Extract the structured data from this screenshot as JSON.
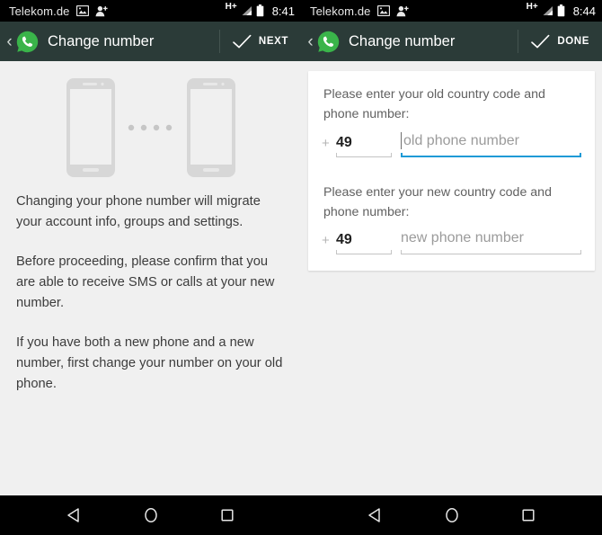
{
  "panels": [
    {
      "status_bar": {
        "carrier": "Telekom.de",
        "network_type": "H+",
        "time": "8:41",
        "icons": [
          "photo-icon",
          "person-add-icon",
          "signal-bars-icon",
          "battery-icon"
        ]
      },
      "app_bar": {
        "back_label": "‹",
        "logo": "whatsapp-logo-icon",
        "title": "Change number",
        "action_icon": "checkmark-icon",
        "action_label": "NEXT"
      },
      "illustration": {
        "name": "two-phones-migration-illustration",
        "dot_count": 4
      },
      "paragraphs": [
        "Changing your phone number will migrate your account info, groups and settings.",
        "Before proceeding, please confirm that you are able to receive SMS or calls at your new number.",
        "If you have both a new phone and a new number, first change your number on your old phone."
      ],
      "nav_bar": {
        "back": "back-triangle-icon",
        "home": "home-circle-icon",
        "recents": "recents-square-icon"
      }
    },
    {
      "status_bar": {
        "carrier": "Telekom.de",
        "network_type": "H+",
        "time": "8:44",
        "icons": [
          "photo-icon",
          "person-add-icon",
          "signal-bars-icon",
          "battery-icon"
        ]
      },
      "app_bar": {
        "back_label": "‹",
        "logo": "whatsapp-logo-icon",
        "title": "Change number",
        "action_icon": "checkmark-icon",
        "action_label": "DONE"
      },
      "form": {
        "groups": [
          {
            "prompt": "Please enter your old country code and phone number:",
            "plus_sign": "+",
            "country_code_value": "49",
            "phone_placeholder": "old phone number",
            "phone_value": "",
            "focused": true
          },
          {
            "prompt": "Please enter your new country code and phone number:",
            "plus_sign": "+",
            "country_code_value": "49",
            "phone_placeholder": "new phone number",
            "phone_value": "",
            "focused": false
          }
        ]
      },
      "nav_bar": {
        "back": "back-triangle-icon",
        "home": "home-circle-icon",
        "recents": "recents-square-icon"
      }
    }
  ],
  "colors": {
    "app_bar_bg": "#2b3b38",
    "status_bar_bg": "#000000",
    "page_bg": "#f0f0f0",
    "card_bg": "#ffffff",
    "accent_focus": "#1f9ad6",
    "whatsapp_green": "#3ab44a",
    "body_text": "#3c3c3c",
    "prompt_text": "#616161",
    "placeholder_text": "#9b9b9b",
    "illustration_grey": "#d6d6d6"
  }
}
